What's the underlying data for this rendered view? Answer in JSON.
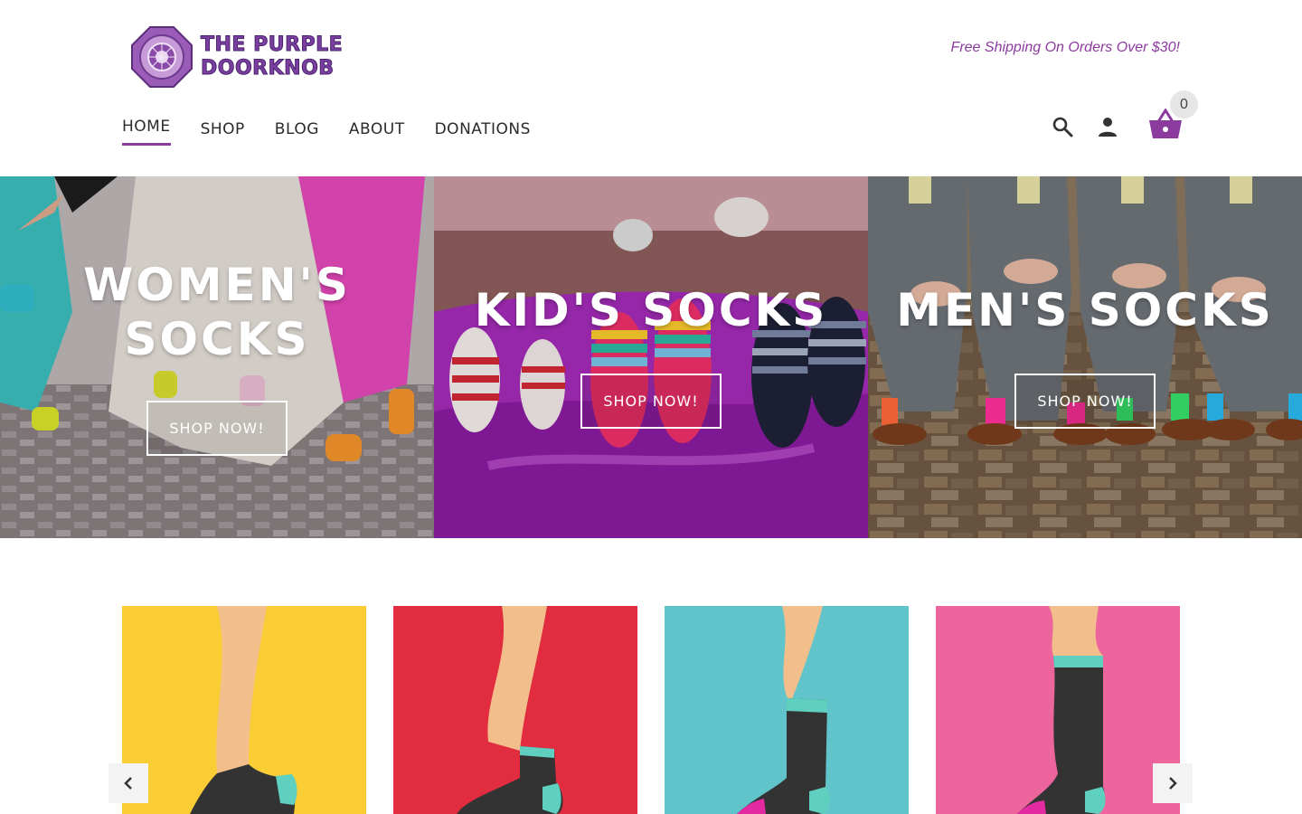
{
  "header": {
    "logo": {
      "line1": "THE PURPLE",
      "line2": "DOORKNOB"
    },
    "promo": "Free Shipping On Orders Over $30!",
    "nav": [
      {
        "label": "HOME",
        "active": true
      },
      {
        "label": "SHOP",
        "active": false
      },
      {
        "label": "BLOG",
        "active": false
      },
      {
        "label": "ABOUT",
        "active": false
      },
      {
        "label": "DONATIONS",
        "active": false
      }
    ],
    "icons": [
      "search-icon",
      "account-icon",
      "cart-icon"
    ],
    "cart_count": "0"
  },
  "hero": {
    "panels": [
      {
        "title_line1": "WOMEN'S",
        "title_line2": "SOCKS",
        "button": "SHOP NOW!"
      },
      {
        "title_line1": "KID'S SOCKS",
        "button": "SHOP NOW!"
      },
      {
        "title_line1": "MEN'S SOCKS",
        "button": "SHOP NOW!"
      }
    ]
  },
  "products": {
    "tiles": [
      {
        "bg": "#fbcd35",
        "sock": "ankle"
      },
      {
        "bg": "#e12d3f",
        "sock": "quarter"
      },
      {
        "bg": "#62c4cb",
        "sock": "crew"
      },
      {
        "bg": "#ec659c",
        "sock": "knee"
      }
    ],
    "arrows": [
      "chevron-left-icon",
      "chevron-right-icon"
    ]
  },
  "colors": {
    "brand": "#8b3a9e",
    "accent_teal": "#5fcfbf"
  }
}
